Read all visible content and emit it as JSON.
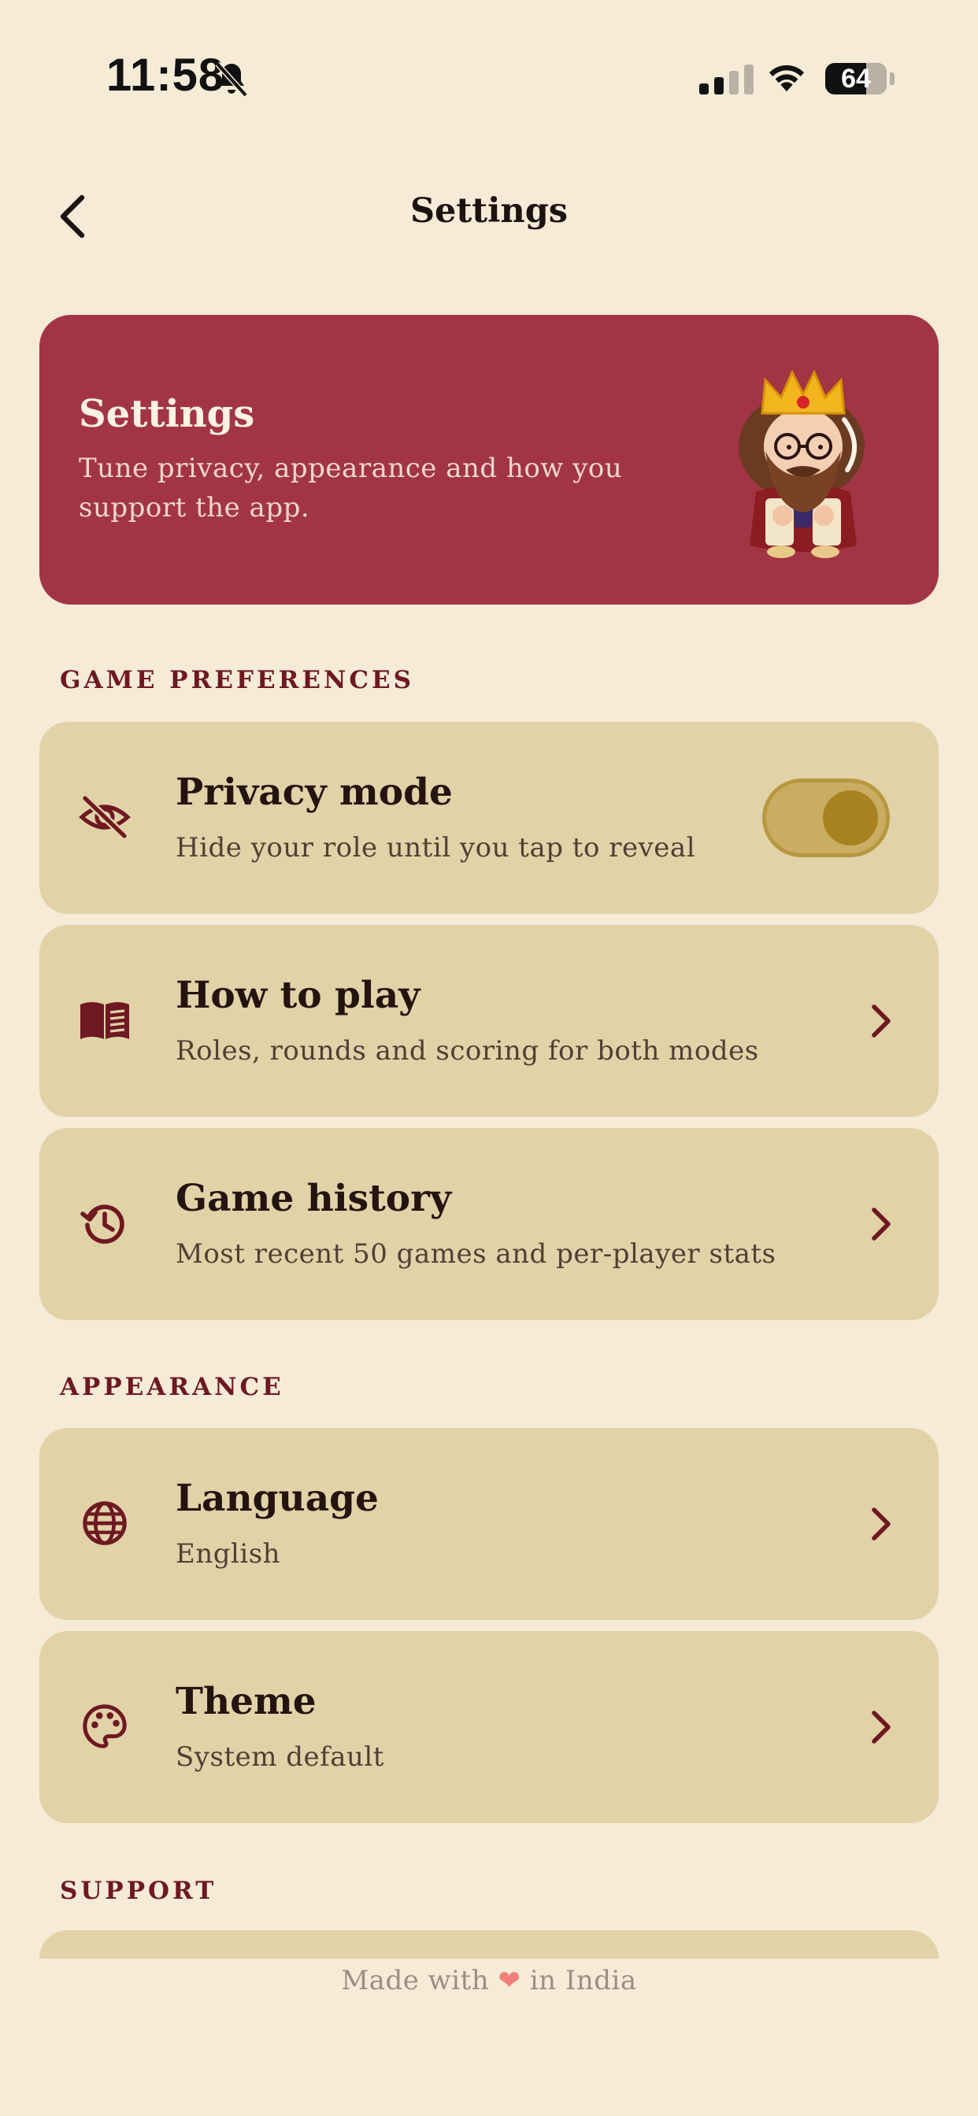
{
  "status": {
    "time": "11:58",
    "battery": "64"
  },
  "header": {
    "title": "Settings"
  },
  "hero": {
    "title": "Settings",
    "subtitle": "Tune privacy, appearance and how you support the app."
  },
  "sections": {
    "game_preferences": "GAME PREFERENCES",
    "appearance": "APPEARANCE",
    "support": "SUPPORT"
  },
  "items": {
    "privacy": {
      "title": "Privacy mode",
      "subtitle": "Hide your role until you tap to reveal",
      "enabled": true
    },
    "how_to_play": {
      "title": "How to play",
      "subtitle": "Roles, rounds and scoring for both modes"
    },
    "game_history": {
      "title": "Game history",
      "subtitle": "Most recent 50 games and per-player stats"
    },
    "language": {
      "title": "Language",
      "subtitle": "English"
    },
    "theme": {
      "title": "Theme",
      "subtitle": "System default"
    }
  },
  "footer": {
    "prefix": "Made with",
    "heart": "❤",
    "suffix": "in India"
  },
  "colors": {
    "accent": "#a23544",
    "card": "#e1d2a8",
    "background": "#f5ebd6",
    "toggle": "#a7821f"
  }
}
